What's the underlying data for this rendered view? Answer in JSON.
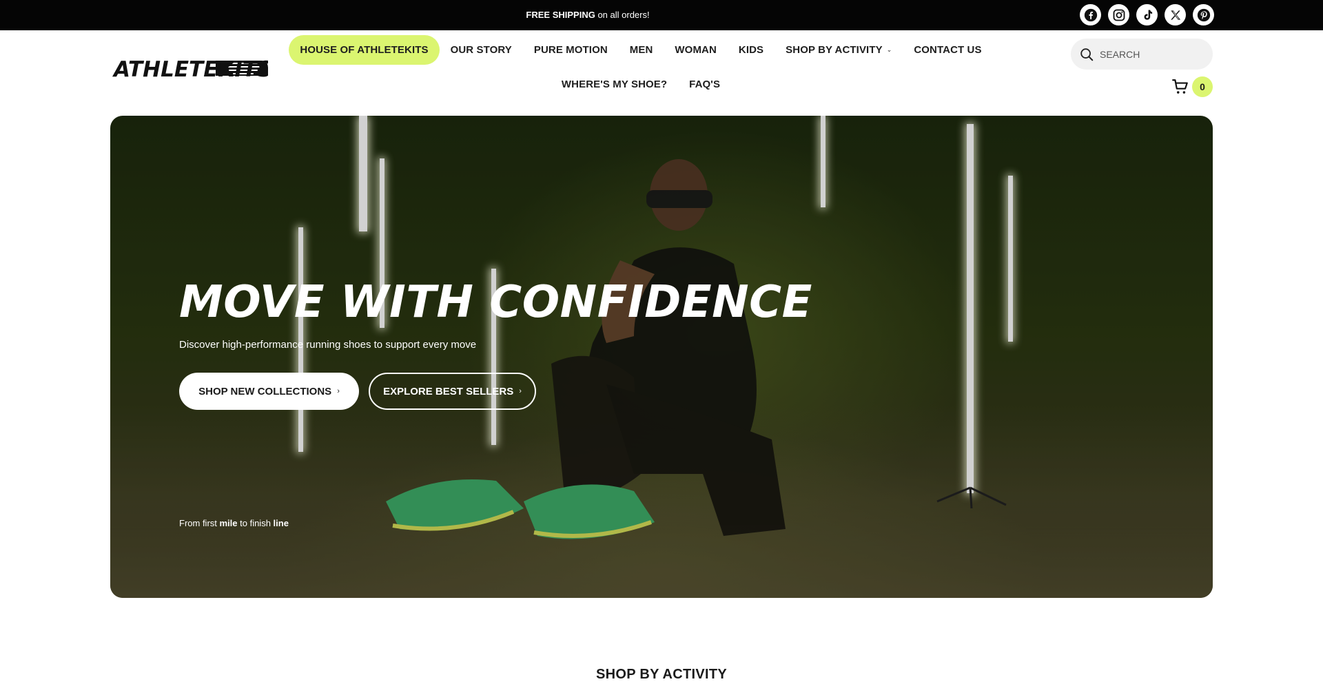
{
  "announcement": {
    "bold": "FREE SHIPPING",
    "rest": " on all orders!"
  },
  "socials": [
    "facebook-icon",
    "instagram-icon",
    "tiktok-icon",
    "x-icon",
    "pinterest-icon"
  ],
  "brand": {
    "logo_text": "ATHLETEKITS",
    "accent": "#dbf570"
  },
  "nav": {
    "row1": [
      {
        "label": "HOUSE OF ATHLETEKITS",
        "active": true
      },
      {
        "label": "OUR STORY"
      },
      {
        "label": "PURE MOTION"
      },
      {
        "label": "MEN"
      },
      {
        "label": "WOMAN"
      },
      {
        "label": "KIDS"
      },
      {
        "label": "SHOP BY ACTIVITY",
        "dropdown": true
      },
      {
        "label": "CONTACT US"
      }
    ],
    "row2": [
      {
        "label": "WHERE'S MY SHOE?"
      },
      {
        "label": "FAQ'S"
      }
    ]
  },
  "search": {
    "placeholder": "SEARCH"
  },
  "cart": {
    "count": "0"
  },
  "hero": {
    "title": "MOVE WITH CONFIDENCE",
    "subtitle": "Discover high-performance running shoes to support every move",
    "primary_cta": "SHOP NEW COLLECTIONS",
    "secondary_cta": "EXPLORE BEST SELLERS",
    "tagline": {
      "p1": "From first ",
      "b1": "mile",
      "p2": " to finish ",
      "b2": "line"
    }
  },
  "next_section": {
    "title": "SHOP BY ACTIVITY"
  }
}
